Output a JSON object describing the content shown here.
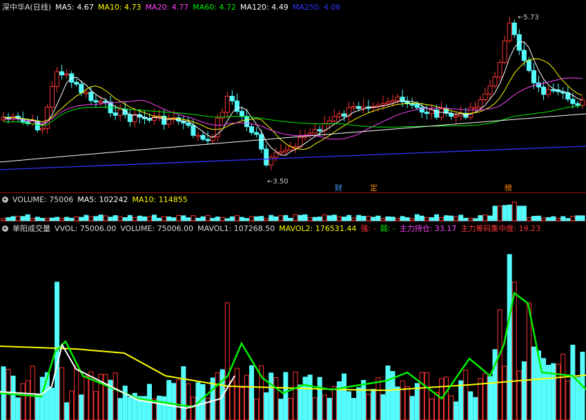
{
  "main_panel": {
    "title": "深中华A(日线)",
    "mas": [
      {
        "label": "MA5: 4.67",
        "color": "#ffffff"
      },
      {
        "label": "MA10: 4.73",
        "color": "#ffff00"
      },
      {
        "label": "MA20: 4.77",
        "color": "#ff44ff"
      },
      {
        "label": "MA60: 4.72",
        "color": "#00ee00"
      },
      {
        "label": "MA120: 4.49",
        "color": "#ffffff"
      },
      {
        "label": "MA250: 4.06",
        "color": "#3333ff"
      }
    ],
    "high_label": "5.73",
    "low_label": "3.50",
    "markers": [
      {
        "label": "财",
        "color": "#4499ff"
      },
      {
        "label": "定",
        "color": "#ff8800"
      },
      {
        "label": "榜",
        "color": "#ff8800"
      }
    ]
  },
  "volume_panel": {
    "title": "VOLUME: 75006",
    "ma5": "MA5: 102242",
    "ma10": "MA10: 114855"
  },
  "indicator_panel": {
    "title": "单阳成交量",
    "items": [
      {
        "label": "VVOL: 75006.00",
        "color": "#dddddd"
      },
      {
        "label": "VOLUME: 75006.00",
        "color": "#dddddd"
      },
      {
        "label": "MAVOL1: 107268.50",
        "color": "#dddddd"
      },
      {
        "label": "MAVOL2: 176531.44",
        "color": "#ffff00"
      },
      {
        "label": "强: -",
        "color": "#ff3333"
      },
      {
        "label": "弱: -",
        "color": "#00ee00"
      },
      {
        "label": "主力持仓: 33.17",
        "color": "#ff44ff"
      },
      {
        "label": "主力筹码集中度: 19.23",
        "color": "#ff3333"
      }
    ]
  },
  "colors": {
    "up": "#ff3333",
    "down": "#54fcfc",
    "divider": "#9b1010"
  }
}
